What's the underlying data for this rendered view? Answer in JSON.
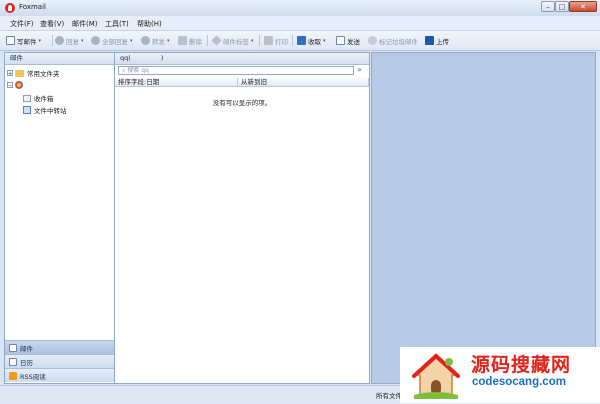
{
  "window": {
    "title": "Foxmail",
    "min_glyph": "–",
    "max_glyph": "□",
    "close_glyph": "✕"
  },
  "menu": [
    "文件(F)",
    "查看(V)",
    "邮件(M)",
    "工具(T)",
    "帮助(H)"
  ],
  "toolbar": {
    "compose": "写邮件",
    "reply": "回复",
    "reply_all": "全部回复",
    "forward": "转发",
    "delete": "删除",
    "tag": "邮件标签",
    "print": "打印",
    "receive": "收取",
    "send": "发送",
    "mark_spam": "标记垃圾邮件",
    "upload": "上传",
    "dropdown_glyph": "▾"
  },
  "left_panel": {
    "header": "邮件",
    "tree": {
      "common_folders": "常用文件夹",
      "account_children": [
        "收件箱",
        "文件中转站"
      ],
      "expand_plus": "+",
      "expand_minus": "−"
    },
    "nav": [
      "邮件",
      "日历",
      "RSS阅读"
    ]
  },
  "middle_panel": {
    "header_prefix": "qq(",
    "header_suffix": ")",
    "search_placeholder": "搜索 qq",
    "search_glyph": "⌕",
    "collapse_glyph": "»",
    "columns": [
      "排序字段:日期",
      "从新到旧"
    ],
    "empty_text": "没有可以显示的项。"
  },
  "status": {
    "text": "所有文件"
  },
  "watermark": {
    "title": "源码搜藏网",
    "url": "codesocang.com"
  },
  "colors": {
    "accent": "#d8262b",
    "panel_border": "#8fa7c9",
    "folder": "#f2c35c",
    "watermark_red": "#e2231a",
    "watermark_blue": "#1b6ec2"
  }
}
